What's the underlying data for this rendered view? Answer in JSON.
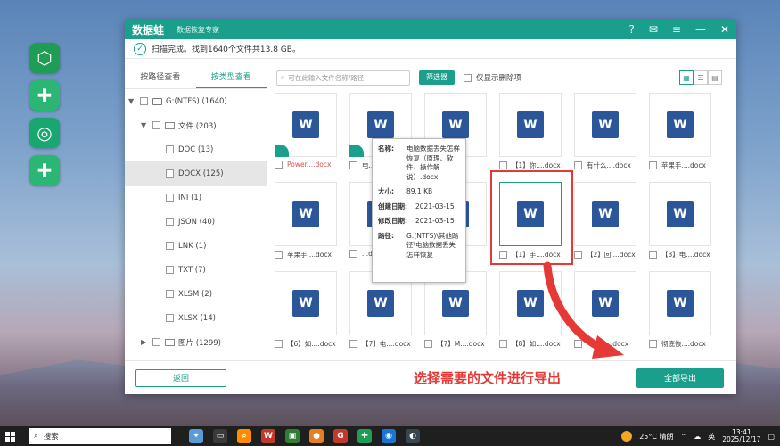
{
  "app": {
    "logo": "数据蛙",
    "subtitle": "数据恢复专家",
    "status": "扫描完成。找到1640个文件共13.8 GB。",
    "controls": {
      "help": "?",
      "feedback": "✉",
      "menu": "≡",
      "minimize": "—",
      "close": "✕"
    }
  },
  "tabs": [
    {
      "label": "按路径查看"
    },
    {
      "label": "按类型查看"
    }
  ],
  "tree": {
    "drive": "G:(NTFS) (1640)",
    "files": "文件 (203)",
    "items": [
      "DOC (13)",
      "DOCX (125)",
      "INI (1)",
      "JSON (40)",
      "LNK (1)",
      "TXT (7)",
      "XLSM (2)",
      "XLSX (14)"
    ],
    "images": "图片 (1299)"
  },
  "toolbar": {
    "search_placeholder": "可在此输入文件名称/路径",
    "filter": "筛选器",
    "only_deleted": "仅显示删除项",
    "views": [
      "▦",
      "☰",
      "▤"
    ]
  },
  "tiles": [
    {
      "label": "Power....docx"
    },
    {
      "label": "电....docx"
    },
    {
      "label": "...docx"
    },
    {
      "label": "【1】你....docx"
    },
    {
      "label": "有什么....docx"
    },
    {
      "label": "苹果手....docx"
    },
    {
      "label": "苹果手....docx"
    },
    {
      "label": "...docx"
    },
    {
      "label": "...docx"
    },
    {
      "label": "【1】手....docx"
    },
    {
      "label": "【2】回....docx"
    },
    {
      "label": "【3】电....docx"
    },
    {
      "label": "【6】如....docx"
    },
    {
      "label": "【7】电....docx"
    },
    {
      "label": "【7】M....docx"
    },
    {
      "label": "【8】如....docx"
    },
    {
      "label": "【9】....docx"
    },
    {
      "label": "彻底恢....docx"
    }
  ],
  "tooltip": {
    "name_key": "名称:",
    "name_val": "电脑数据丢失怎样恢复（原理、软件、操作解说）.docx",
    "size_key": "大小:",
    "size_val": "89.1 KB",
    "created_key": "创建日期:",
    "created_val": "2021-03-15",
    "modified_key": "修改日期:",
    "modified_val": "2021-03-15",
    "path_key": "路径:",
    "path_val": "G:(NTFS)\\其他路径\\电脑数据丢失怎样恢复"
  },
  "footer": {
    "back": "返回",
    "annotation": "选择需要的文件进行导出",
    "export": "全部导出"
  },
  "taskbar": {
    "search": "搜索",
    "weather": "25°C 晴朗",
    "ime": "英",
    "time": "13:41",
    "date": "2025/12/17"
  },
  "colors": {
    "accent": "#1a9f8c",
    "annotation": "#e53935",
    "word": "#2b579a"
  }
}
